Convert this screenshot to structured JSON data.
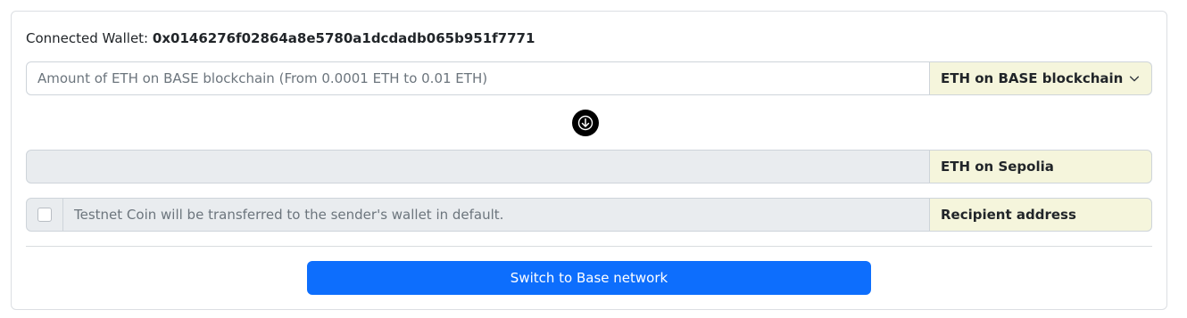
{
  "wallet": {
    "label": "Connected Wallet:",
    "address": "0x0146276f02864a8e5780a1dcdadb065b951f7771"
  },
  "from": {
    "placeholder": "Amount of ETH on BASE blockchain (From 0.0001 ETH to 0.01 ETH)",
    "value": "",
    "token_select": "ETH on BASE blockchain",
    "icon": "chevron-down-icon"
  },
  "swap_icon": "arrow-down-circle-icon",
  "to": {
    "value": "",
    "token_label": "ETH on Sepolia"
  },
  "recipient": {
    "checked": false,
    "text": "Testnet Coin will be transferred to the sender's wallet in default.",
    "addon_label": "Recipient address"
  },
  "action": {
    "switch_label": "Switch to Base network"
  },
  "colors": {
    "accent": "#0d6efd",
    "addon_bg": "#f5f5dc",
    "disabled_bg": "#e9ecef"
  }
}
